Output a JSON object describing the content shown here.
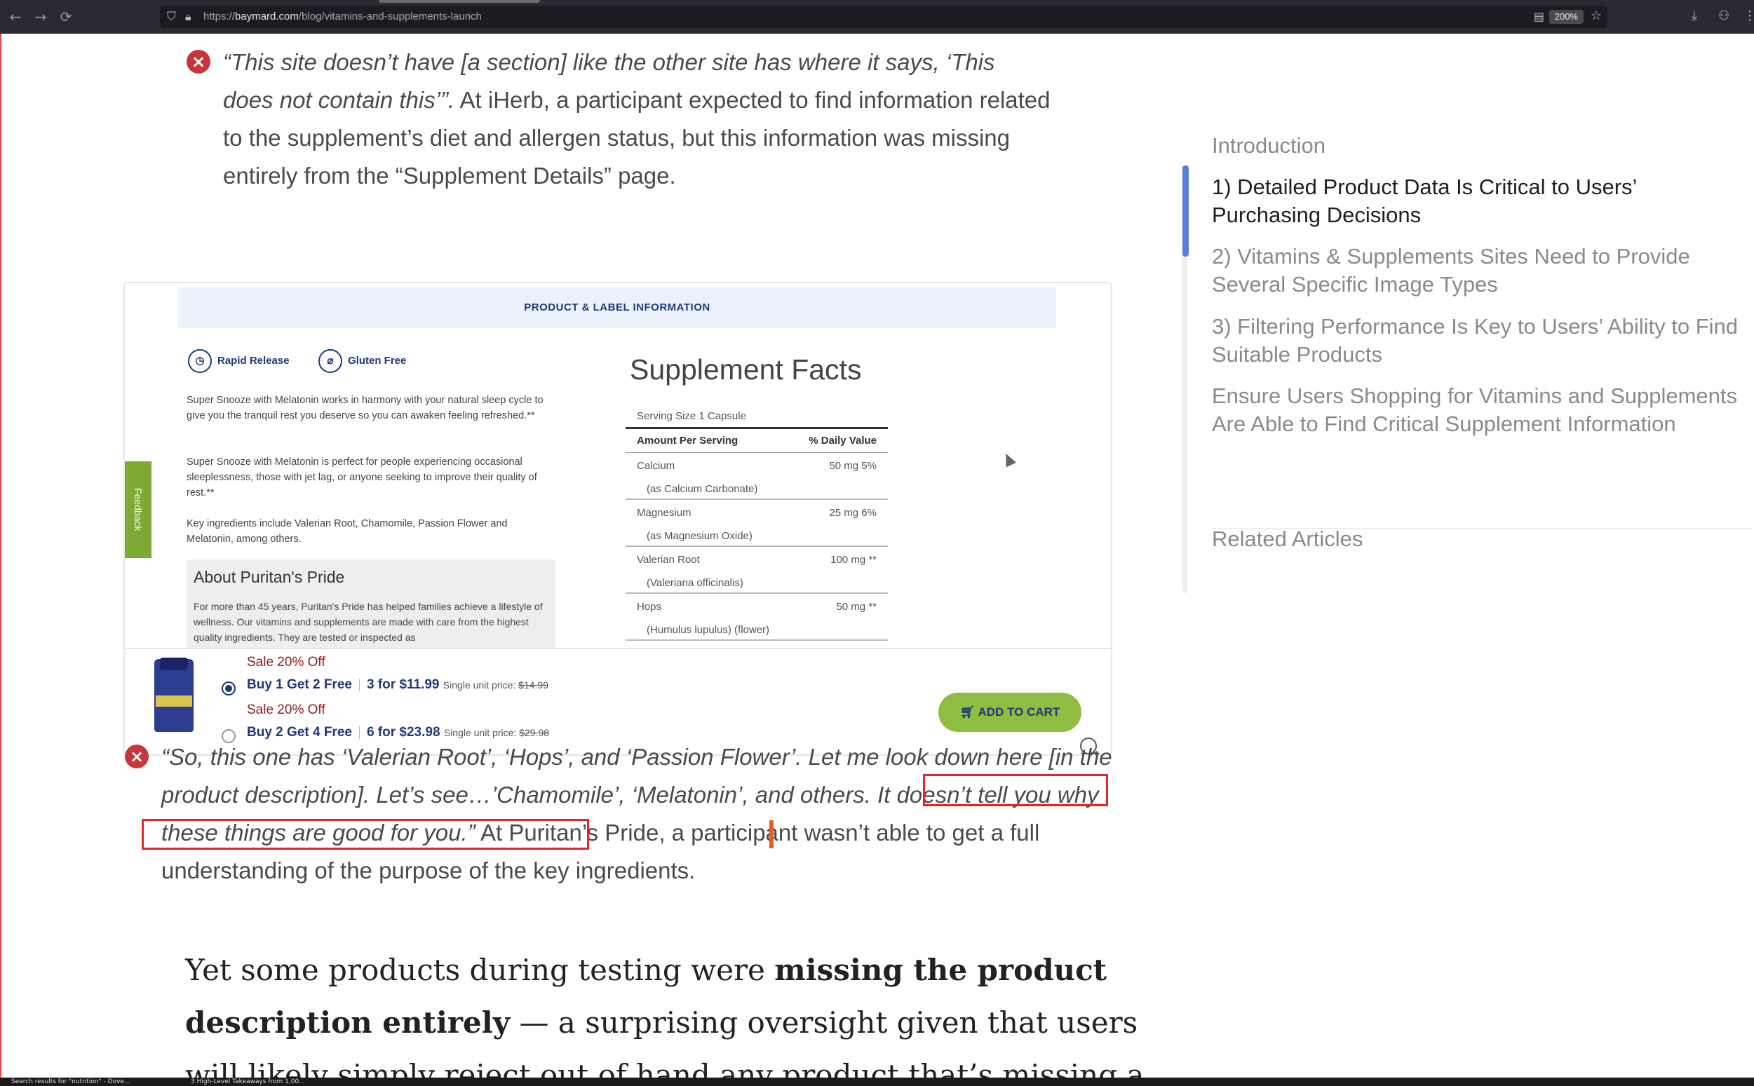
{
  "browser": {
    "url_prefix": "https://",
    "url_domain": "baymard.com",
    "url_path": "/blog/vitamins-and-supplements-launch",
    "zoom": "200%",
    "icons": [
      "back-icon",
      "forward-icon",
      "reload-icon",
      "shield-icon",
      "lock-icon",
      "reader-icon",
      "star-icon",
      "download-icon",
      "extension-icon"
    ]
  },
  "quote1": {
    "quote": "“This site doesn’t have [a section] like the other site has where it says, ‘This does not contain this’”.",
    "text": " At iHerb, a participant expected to find information related to the supplement’s diet and allergen status, but this information was missing entirely from the “Supplement Details” page."
  },
  "figure": {
    "header": "PRODUCT & LABEL INFORMATION",
    "badge1": "Rapid Release",
    "badge2": "Gluten Free",
    "para1": "Super Snooze with Melatonin works in harmony with your natural sleep cycle to give you the tranquil rest you deserve so you can awaken feeling refreshed.**",
    "para2": "Super Snooze with Melatonin is perfect for people experiencing occasional sleeplessness, those with jet lag, or anyone seeking to improve their quality of rest.**",
    "para3": "Key ingredients include Valerian Root, Chamomile, Passion Flower and Melatonin, among others.",
    "about_title": "About Puritan's Pride",
    "about_text": "For more than 45 years, Puritan's Pride has helped families achieve a lifestyle of wellness. Our vitamins and supplements are made with care from the highest quality ingredients. They are tested or inspected as",
    "feedback": "Feedback",
    "facts_title": "Supplement Facts",
    "serving": "Serving Size 1 Capsule",
    "col_amount": "Amount Per Serving",
    "col_dv": "% Daily Value",
    "rows": [
      {
        "name": "Calcium",
        "amount": "50 mg 5%",
        "sub": "(as Calcium Carbonate)"
      },
      {
        "name": "Magnesium",
        "amount": "25 mg 6%",
        "sub": "(as Magnesium Oxide)"
      },
      {
        "name": "Valerian Root",
        "amount": "100 mg **",
        "sub": "(Valeriana officinalis)"
      },
      {
        "name": "Hops",
        "amount": "50 mg **",
        "sub": "(Humulus lupulus) (flower)"
      }
    ],
    "offers": [
      {
        "sale": "Sale 20% Off",
        "deal": "Buy 1 Get 2 Free",
        "price": "3 for $11.99",
        "single_label": "Single unit price:",
        "single_price": "$14.99",
        "selected": true
      },
      {
        "sale": "Sale 20% Off",
        "deal": "Buy 2 Get 4 Free",
        "price": "6 for $23.98",
        "single_label": "Single unit price:",
        "single_price": "$29.98",
        "selected": false
      }
    ],
    "add_to_cart": "ADD TO CART"
  },
  "quote2": {
    "quote_a": "“So, this one has ‘Valerian Root’, ‘Hops’, and ‘Passion Flower’. Let me look down here [in the product description]. Let’s see…’Chamomile’, ‘Melatonin’, and others.",
    "quote_b": " It doesn’t tell you why these things are good for you.”",
    "text": " At Puritan’s Pride, a participant wasn’t able to get a full understanding of the purpose of the key ingredients."
  },
  "body": {
    "pre": "Yet some products during testing were ",
    "bold": "missing the product description entirely",
    "post": " — a surprising oversight given that users will likely simply reject out of hand any product that’s missing a"
  },
  "toc": {
    "items": [
      {
        "label": "Introduction",
        "active": false
      },
      {
        "label": "1) Detailed Product Data Is Critical to Users’ Purchasing Decisions",
        "active": true
      },
      {
        "label": "2) Vitamins & Supplements Sites Need to Provide Several Specific Image Types",
        "active": false
      },
      {
        "label": "3) Filtering Performance Is Key to Users’ Ability to Find Suitable Products",
        "active": false
      },
      {
        "label": "Ensure Users Shopping for Vitamins and Supplements Are Able to Find Critical Supplement Information",
        "active": false
      }
    ],
    "related": "Related Articles"
  },
  "taskbar": {
    "item1": "Search results for \"nutrition\" - Dove...",
    "item2": "3 High-Level Takeaways from 1,00..."
  }
}
